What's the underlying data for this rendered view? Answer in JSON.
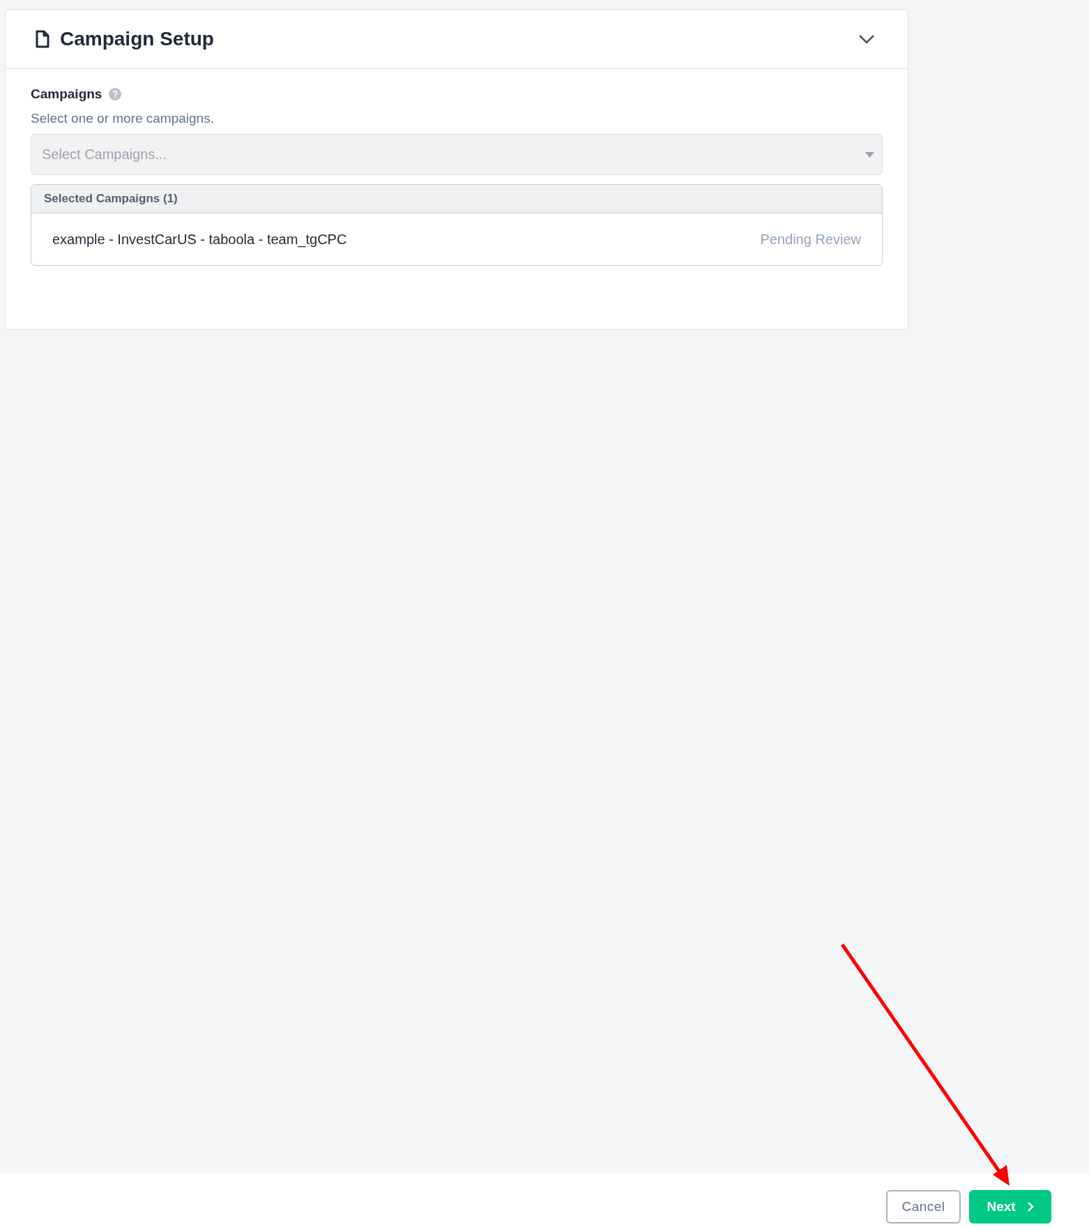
{
  "panel": {
    "title": "Campaign Setup",
    "expanded": true
  },
  "field": {
    "label": "Campaigns",
    "help": "Select one or more campaigns.",
    "placeholder": "Select Campaigns..."
  },
  "selected_list": {
    "header": "Selected Campaigns (1)",
    "items": [
      {
        "name": "example - InvestCarUS - taboola - team_tgCPC",
        "status": "Pending Review"
      }
    ]
  },
  "footer": {
    "buttons": [
      {
        "label": "Cancel",
        "kind": "secondary"
      },
      {
        "label": "Next",
        "kind": "primary"
      }
    ]
  },
  "annotation": {
    "kind": "arrow",
    "color": "#ff0000"
  }
}
